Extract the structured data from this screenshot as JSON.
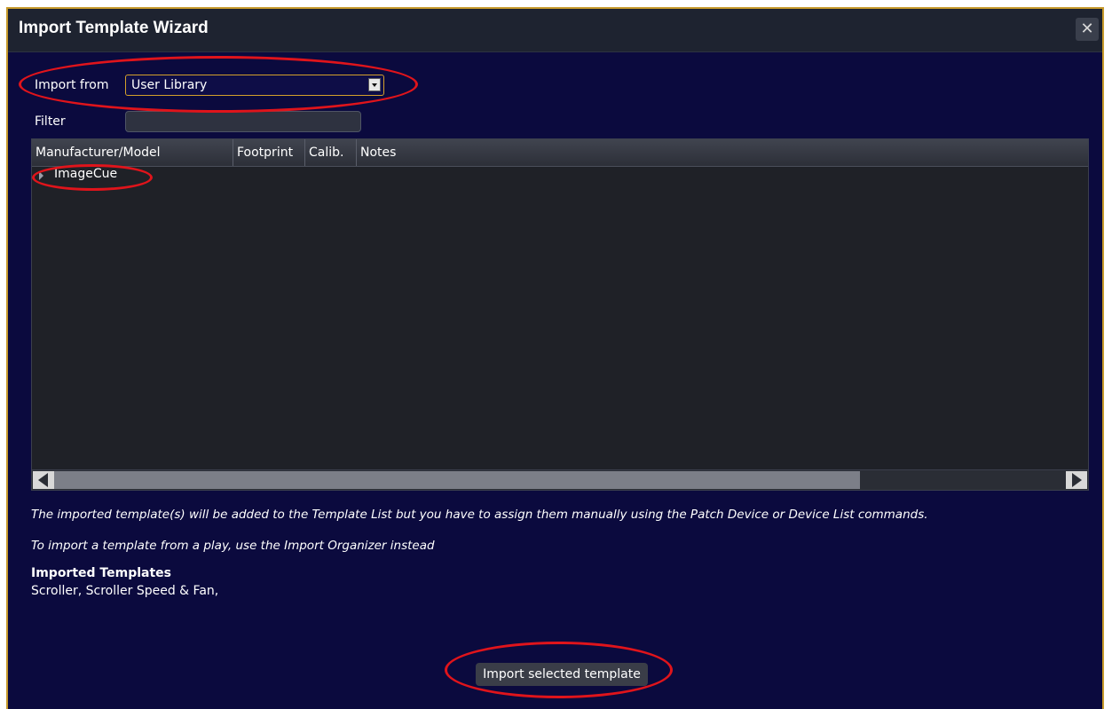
{
  "dialog": {
    "title": "Import Template Wizard",
    "close_icon": "close-icon"
  },
  "import_from": {
    "label": "Import from",
    "value": "User Library"
  },
  "filter": {
    "label": "Filter",
    "value": ""
  },
  "table": {
    "columns": [
      "Manufacturer/Model",
      "Footprint",
      "Calib.",
      "Notes"
    ],
    "rows": [
      {
        "label": "ImageCue",
        "expanded": false
      }
    ]
  },
  "notes": {
    "line1": "The imported template(s) will be added to the Template List but you have to assign them manually using the Patch Device or Device List commands.",
    "line2": "To import a template from a play, use the Import Organizer instead"
  },
  "imported": {
    "title": "Imported Templates",
    "list": "Scroller, Scroller Speed & Fan,"
  },
  "actions": {
    "import_label": "Import selected template"
  },
  "colors": {
    "dialog_bg": "#0b0a3e",
    "border_accent": "#c79a2b",
    "annotation_red": "#e0141b"
  }
}
